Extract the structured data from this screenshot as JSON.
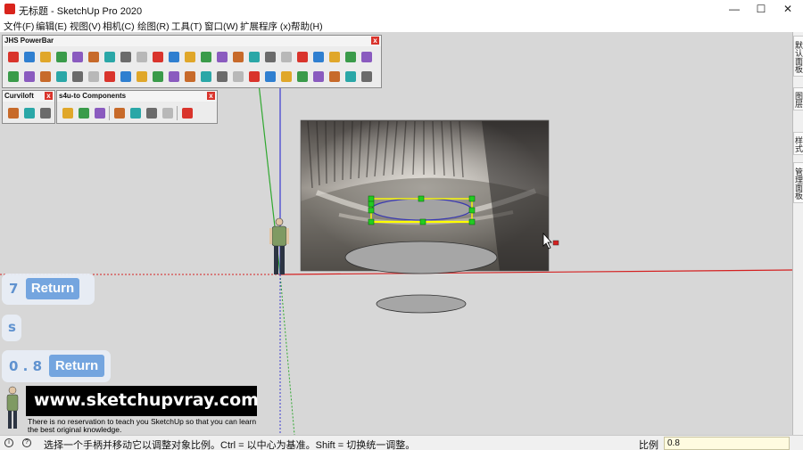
{
  "window": {
    "title": "无标题 - SketchUp Pro 2020",
    "controls": {
      "minimize": "—",
      "maximize": "☐",
      "close": "✕"
    }
  },
  "menu": [
    "文件(F)",
    "编辑(E)",
    "视图(V)",
    "相机(C)",
    "绘图(R)",
    "工具(T)",
    "窗口(W)",
    "扩展程序 (x)",
    "帮助(H)"
  ],
  "toolbars": {
    "jhs": {
      "title": "JHS PowerBar",
      "close": "x"
    },
    "curviloft": {
      "title": "Curviloft",
      "close": "x"
    },
    "s4u": {
      "title": "s4u-to Components",
      "close": "x"
    }
  },
  "right_panel_tabs": [
    "默认面板",
    "图层",
    "样式",
    "管理面板"
  ],
  "keystroke_overlay": {
    "row1": {
      "key": "7",
      "action": "Return"
    },
    "row2": {
      "key": "s"
    },
    "row3": {
      "key": "0 . 8",
      "action": "Return"
    }
  },
  "watermark": {
    "url": "www.sketchupvray.com",
    "caption_line1": "There is no reservation to teach you SketchUp so that you can learn",
    "caption_line2": "the best original knowledge."
  },
  "statusbar": {
    "hint": "选择一个手柄并移动它以调整对象比例。Ctrl = 以中心为基准。Shift = 切换统一调整。",
    "measure_label": "比例",
    "measure_value": "0.8"
  },
  "colors": {
    "viewport_bg": "#d7d7d7",
    "red_axis": "#d42020",
    "green_axis": "#2fa82f",
    "blue_axis": "#3a3ad0",
    "selection_box": "#ffff00",
    "grip_handle": "#22cc22",
    "key_accent": "#6fa3e0"
  },
  "icons": {
    "app": "sketchup-logo-icon",
    "status_left": "circle-info-icon",
    "status_help": "help-icon",
    "cursor": "mouse-pointer-icon"
  }
}
